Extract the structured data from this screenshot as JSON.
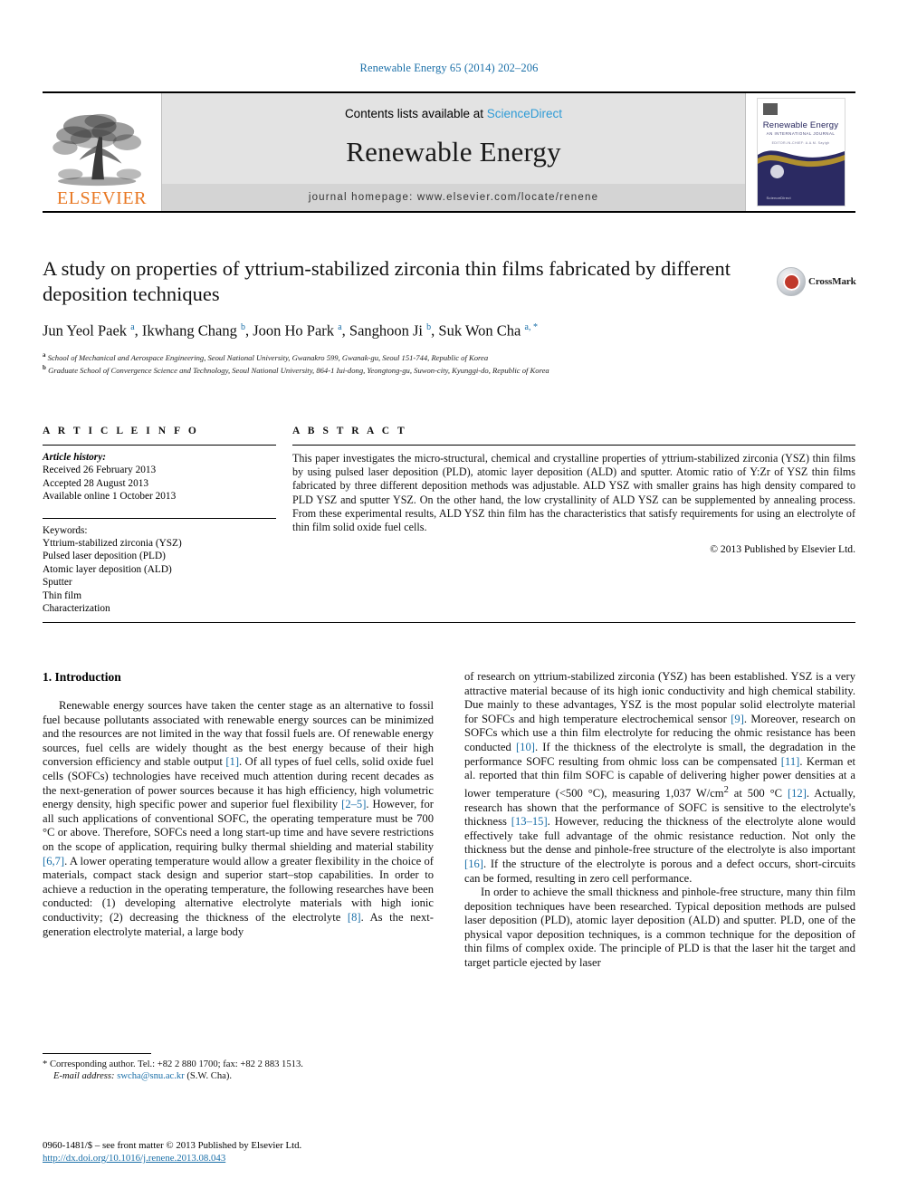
{
  "running_head": "Renewable Energy 65 (2014) 202–206",
  "masthead": {
    "publisher_name": "ELSEVIER",
    "contents_prefix": "Contents lists available at ",
    "contents_link": "ScienceDirect",
    "journal_title": "Renewable Energy",
    "homepage": "journal homepage: www.elsevier.com/locate/renene",
    "cover": {
      "title": "Renewable Energy",
      "subtitle": "AN INTERNATIONAL JOURNAL",
      "subtitle2": "EDITOR-IN-CHIEF:  A.A.M. Sayigh",
      "footer": "ScienceDirect"
    }
  },
  "article": {
    "title": "A study on properties of yttrium-stabilized zirconia thin films fabricated by different deposition techniques",
    "authors": "Jun Yeol Paek a, Ikwhang Chang b, Joon Ho Park a, Sanghoon Ji b, Suk Won Cha a, *",
    "affiliation_a": "School of Mechanical and Aerospace Engineering, Seoul National University, Gwanakro 599, Gwanak-gu, Seoul 151-744, Republic of Korea",
    "affiliation_b": "Graduate School of Convergence Science and Technology, Seoul National University, 864-1 Iui-dong, Yeongtong-gu, Suwon-city, Kyunggi-do, Republic of Korea",
    "crossmark_label": "CrossMark"
  },
  "info": {
    "heading": "A R T I C L E  I N F O",
    "history_label": "Article history:",
    "history": [
      "Received 26 February 2013",
      "Accepted 28 August 2013",
      "Available online 1 October 2013"
    ],
    "keywords_label": "Keywords:",
    "keywords": [
      "Yttrium-stabilized zirconia (YSZ)",
      "Pulsed laser deposition (PLD)",
      "Atomic layer deposition (ALD)",
      "Sputter",
      "Thin film",
      "Characterization"
    ]
  },
  "abstract": {
    "heading": "A B S T R A C T",
    "text": "This paper investigates the micro-structural, chemical and crystalline properties of yttrium-stabilized zirconia (YSZ) thin films by using pulsed laser deposition (PLD), atomic layer deposition (ALD) and sputter. Atomic ratio of Y:Zr of YSZ thin films fabricated by three different deposition methods was adjustable. ALD YSZ with smaller grains has high density compared to PLD YSZ and sputter YSZ. On the other hand, the low crystallinity of ALD YSZ can be supplemented by annealing process. From these experimental results, ALD YSZ thin film has the characteristics that satisfy requirements for using an electrolyte of thin film solid oxide fuel cells.",
    "copyright": "© 2013 Published by Elsevier Ltd."
  },
  "body": {
    "section_number": "1.",
    "section_title": "Introduction",
    "left_paragraph_1_a": "Renewable energy sources have taken the center stage as an alternative to fossil fuel because pollutants associated with renewable energy sources can be minimized and the resources are not limited in the way that fossil fuels are. Of renewable energy sources, fuel cells are widely thought as the best energy because of their high conversion efficiency and stable output ",
    "ref_1": "[1]",
    "left_paragraph_1_b": ". Of all types of fuel cells, solid oxide fuel cells (SOFCs) technologies have received much attention during recent decades as the next-generation of power sources because it has high efficiency, high volumetric energy density, high specific power and superior fuel flexibility ",
    "ref_2_5": "[2–5]",
    "left_paragraph_1_c": ". However, for all such applications of conventional SOFC, the operating temperature must be 700 °C or above. Therefore, SOFCs need a long start-up time and have severe restrictions on the scope of application, requiring bulky thermal shielding and material stability ",
    "ref_6_7": "[6,7]",
    "left_paragraph_1_d": ". A lower operating temperature would allow a greater flexibility in the choice of materials, compact stack design and superior start–stop capabilities. In order to achieve a reduction in the operating temperature, the following researches have been conducted: (1) developing alternative electrolyte materials with high ionic conductivity; (2) decreasing the thickness of the electrolyte ",
    "ref_8": "[8]",
    "left_paragraph_1_e": ". As the next-generation electrolyte material, a large body",
    "right_paragraph_1_a": "of research on yttrium-stabilized zirconia (YSZ) has been established. YSZ is a very attractive material because of its high ionic conductivity and high chemical stability. Due mainly to these advantages, YSZ is the most popular solid electrolyte material for SOFCs and high temperature electrochemical sensor ",
    "ref_9": "[9]",
    "right_paragraph_1_b": ". Moreover, research on SOFCs which use a thin film electrolyte for reducing the ohmic resistance has been conducted ",
    "ref_10": "[10]",
    "right_paragraph_1_c": ". If the thickness of the electrolyte is small, the degradation in the performance SOFC resulting from ohmic loss can be compensated ",
    "ref_11": "[11]",
    "right_paragraph_1_d": ". Kerman et al. reported that thin film SOFC is capable of delivering higher power densities at a lower temperature (<500 °C), measuring 1,037 W/cm",
    "superscript_2": "2",
    "right_paragraph_1_e": " at 500 °C ",
    "ref_12": "[12]",
    "right_paragraph_1_f": ". Actually, research has shown that the performance of SOFC is sensitive to the electrolyte's thickness ",
    "ref_13_15": "[13–15]",
    "right_paragraph_1_g": ". However, reducing the thickness of the electrolyte alone would effectively take full advantage of the ohmic resistance reduction. Not only the thickness but the dense and pinhole-free structure of the electrolyte is also important ",
    "ref_16": "[16]",
    "right_paragraph_1_h": ". If the structure of the electrolyte is porous and a defect occurs, short-circuits can be formed, resulting in zero cell performance.",
    "right_paragraph_2": "In order to achieve the small thickness and pinhole-free structure, many thin film deposition techniques have been researched. Typical deposition methods are pulsed laser deposition (PLD), atomic layer deposition (ALD) and sputter. PLD, one of the physical vapor deposition techniques, is a common technique for the deposition of thin films of complex oxide. The principle of PLD is that the laser hit the target and target particle ejected by laser"
  },
  "footnote": {
    "star": "*",
    "text": " Corresponding author. Tel.: +82 2 880 1700; fax: +82 2 883 1513.",
    "email_label": "E-mail address:",
    "email": "swcha@snu.ac.kr",
    "email_suffix": " (S.W. Cha)."
  },
  "footer": {
    "issn_line": "0960-1481/$ – see front matter © 2013 Published by Elsevier Ltd.",
    "doi": "http://dx.doi.org/10.1016/j.renene.2013.08.043"
  }
}
